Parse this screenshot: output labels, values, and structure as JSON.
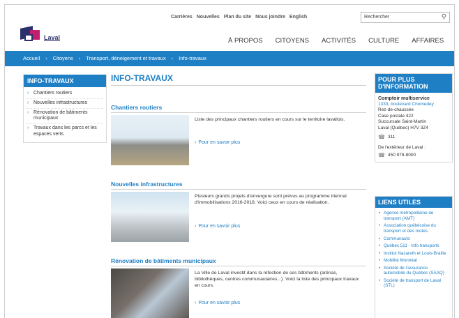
{
  "util_nav": [
    "Carrières",
    "Nouvelles",
    "Plan du site",
    "Nous joindre",
    "English"
  ],
  "search": {
    "placeholder": "Rechercher",
    "icon": "search-icon"
  },
  "logo": {
    "name": "Laval"
  },
  "main_nav": [
    "À PROPOS",
    "CITOYENS",
    "ACTIVITÉS",
    "CULTURE",
    "AFFAIRES"
  ],
  "breadcrumb": [
    "Accueil",
    "Citoyens",
    "Transport, déneigement et travaux",
    "Info-travaux"
  ],
  "sidebar": {
    "title": "INFO-TRAVAUX",
    "items": [
      "Chantiers routiers",
      "Nouvelles infrastructures",
      "Rénovation de bâtiments municipaux",
      "Travaux dans les parcs et les espaces verts"
    ]
  },
  "main": {
    "title": "INFO-TRAVAUX",
    "sections": [
      {
        "title": "Chantiers routiers",
        "text": "Liste des principaux chantiers routiers en cours sur le territoire lavallois.",
        "more": "Pour en savoir plus"
      },
      {
        "title": "Nouvelles infrastructures",
        "text": "Plusieurs grands projets d'envergure sont prévus au programme triennal d'immobilisations 2016-2018. Voici ceux en cours de réalisation.",
        "more": "Pour en savoir plus"
      },
      {
        "title": "Rénovation de bâtiments municipaux",
        "text": "La Ville de Laval investit dans la réfection de ses bâtiments (arénas, bibliothèques, centres communautaires...). Voici la liste des principaux travaux en cours.",
        "more": "Pour en savoir plus"
      }
    ]
  },
  "info_box": {
    "title": "POUR PLUS D'INFORMATION",
    "name": "Comptoir multiservice",
    "address_link": "1333, boulevard Chomedey",
    "address_lines": [
      "Rez-de-chaussée",
      "Case postale 422",
      "Succursale Saint-Martin",
      "Laval (Québec) H7V 3Z4"
    ],
    "phone": "311",
    "outside_label": "De l'extérieur de Laval :",
    "outside_phone": "450 978-8000"
  },
  "links_box": {
    "title": "LIENS UTILES",
    "items": [
      "Agence métropolitaine de transport (AMT)",
      "Association québécoise du transport et des routes",
      "Communauto",
      "Québec 511 - Info transports",
      "Institut Nazareth et Louis-Braille",
      "Mobilité Montréal",
      "Société de l'assurance automobile du Québec (SAAQ)",
      "Société de transport de Laval (STL)"
    ]
  },
  "colors": {
    "accent": "#1e7fc5",
    "brand_navy": "#2b2f6c",
    "brand_magenta": "#c21f6f"
  }
}
